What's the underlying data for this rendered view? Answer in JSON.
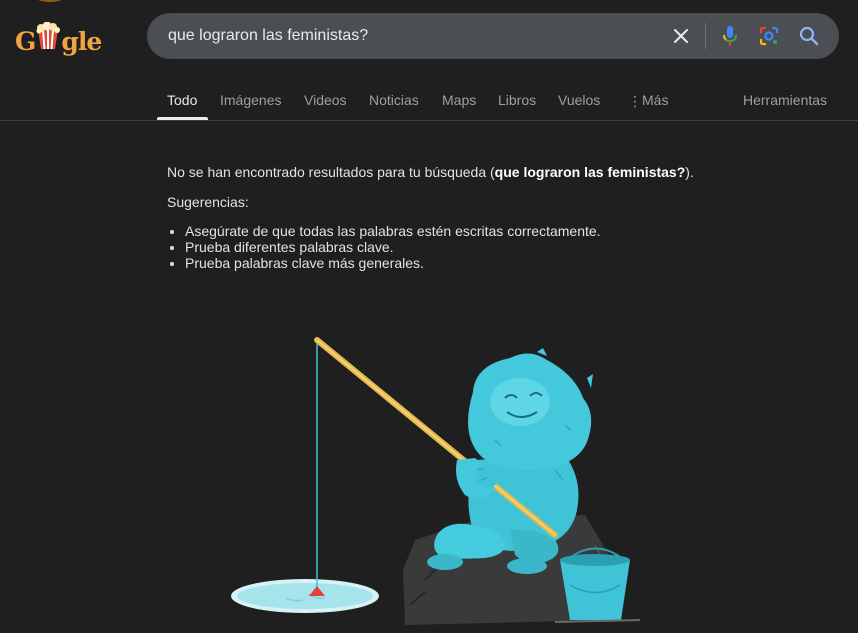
{
  "logo": {
    "text_left": "G",
    "text_right": "gle"
  },
  "search": {
    "query": "que lograron las feministas?"
  },
  "tabs": [
    {
      "label": "Todo"
    },
    {
      "label": "Imágenes"
    },
    {
      "label": "Videos"
    },
    {
      "label": "Noticias"
    },
    {
      "label": "Maps"
    },
    {
      "label": "Libros"
    },
    {
      "label": "Vuelos"
    },
    {
      "label": "Más"
    }
  ],
  "tools_label": "Herramientas",
  "results": {
    "no_results_prefix": "No se han encontrado resultados para tu búsqueda (",
    "no_results_query": "que lograron las feministas?",
    "no_results_suffix": ").",
    "suggestions_title": "Sugerencias:",
    "suggestions": [
      "Asegúrate de que todas las palabras estén escritas correctamente.",
      "Prueba diferentes palabras clave.",
      "Prueba palabras clave más generales."
    ]
  },
  "colors": {
    "background": "#1f1f1f",
    "search_box": "#4b4f54",
    "logo": "#f0a442",
    "mascot": "#3fc3d6",
    "rod": "#e6b84a",
    "ice": "#b8e8ee"
  },
  "icons": [
    "clear-icon",
    "mic-icon",
    "lens-icon",
    "search-icon",
    "more-dots-icon"
  ]
}
